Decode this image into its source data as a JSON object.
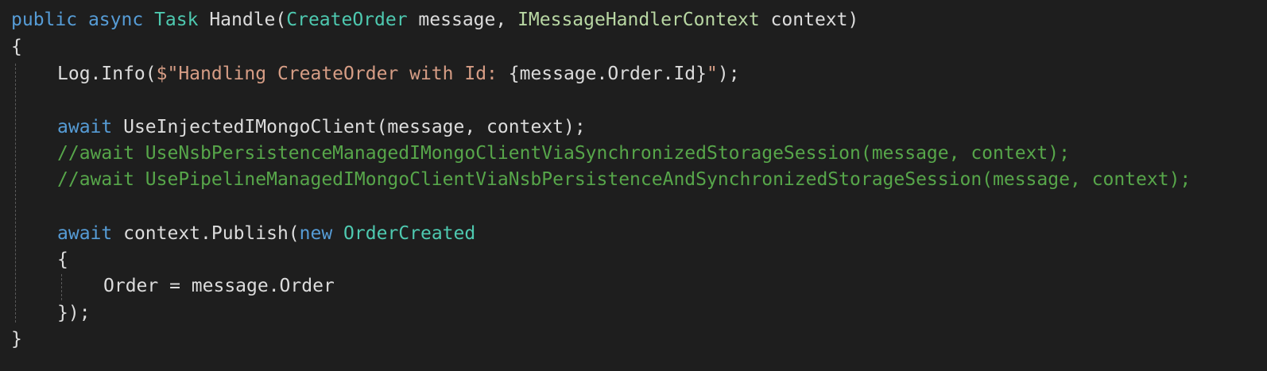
{
  "colors": {
    "background": "#1e1e1e",
    "keyword": "#569cd6",
    "type": "#4ec9b0",
    "interface": "#b8d7a3",
    "string": "#d69d85",
    "comment": "#57a64a",
    "text": "#dcdcdc"
  },
  "code": {
    "line1": {
      "public_kw": "public",
      "async_kw": "async",
      "task_type": "Task",
      "method_name": "Handle(",
      "param_type": "CreateOrder",
      "param_name": " message, ",
      "context_type": "IMessageHandlerContext",
      "context_name": " context)"
    },
    "line2": {
      "text": "{"
    },
    "line3": {
      "prefix": "Log.Info(",
      "string": "$\"Handling CreateOrder with Id: ",
      "interp": "{message.Order.Id}",
      "string_end": "\"",
      "suffix": ");"
    },
    "line5": {
      "await_kw": "await",
      "call": " UseInjectedIMongoClient(message, context);"
    },
    "line6": {
      "comment": "//await UseNsbPersistenceManagedIMongoClientViaSynchronizedStorageSession(message, context);"
    },
    "line7": {
      "comment": "//await UsePipelineManagedIMongoClientViaNsbPersistenceAndSynchronizedStorageSession(message, context);"
    },
    "line9": {
      "await_kw": "await",
      "call": " context.Publish(",
      "new_kw": "new",
      "type": " OrderCreated"
    },
    "line10": {
      "text": "{"
    },
    "line11": {
      "text": "Order = message.Order"
    },
    "line12": {
      "text": "});"
    },
    "line13": {
      "text": "}"
    }
  }
}
